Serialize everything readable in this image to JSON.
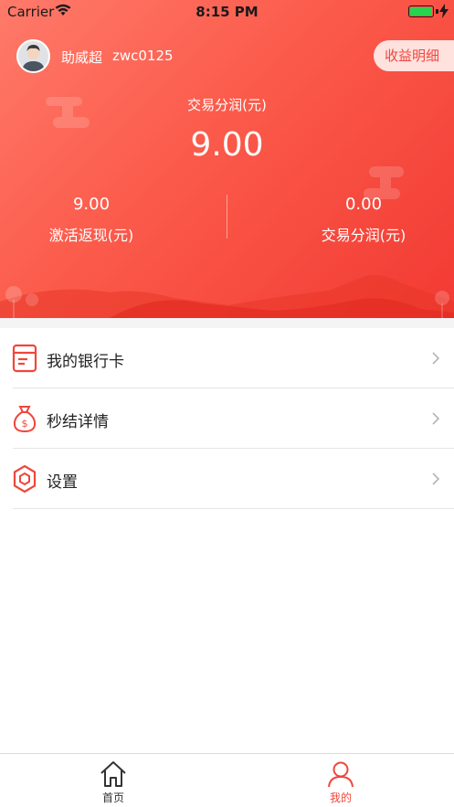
{
  "status_bar": {
    "carrier": "Carrier",
    "time": "8:15 PM",
    "wifi_icon": "wifi-icon",
    "battery_icon": "battery-icon",
    "battery_level": 1.0
  },
  "header": {
    "avatar_icon": "avatar",
    "user_name": "助威超",
    "account": "zwc0125",
    "earnings_detail_button": "收益明细",
    "main_label": "交易分润(元)",
    "main_value": "9.00",
    "stats": [
      {
        "value": "9.00",
        "label": "激活返现(元)"
      },
      {
        "value": "0.00",
        "label": "交易分润(元)"
      }
    ],
    "colors": {
      "gradient_start": "#ff7a6a",
      "gradient_end": "#f23a33"
    }
  },
  "menu": {
    "items": [
      {
        "label": "我的银行卡",
        "icon": "bank-card-icon"
      },
      {
        "label": "秒结详情",
        "icon": "money-bag-icon"
      },
      {
        "label": "设置",
        "icon": "settings-hexagon-icon"
      }
    ]
  },
  "tab_bar": {
    "tabs": [
      {
        "label": "首页",
        "icon": "home-icon",
        "active": false
      },
      {
        "label": "我的",
        "icon": "user-icon",
        "active": true
      }
    ],
    "active_color": "#f0463c"
  }
}
